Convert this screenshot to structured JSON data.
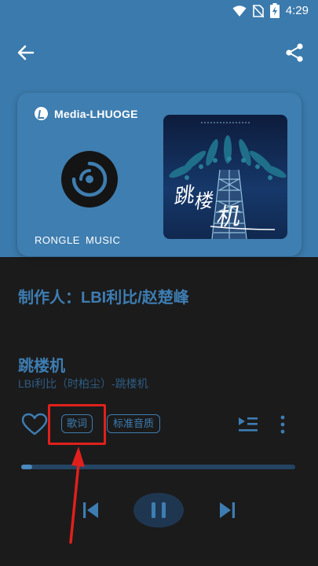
{
  "status_bar": {
    "time": "4:29"
  },
  "colors": {
    "header_bg": "#3b7aac",
    "accent": "#3d7db2",
    "body_bg": "#1b1b1b",
    "highlight": "#e0201c"
  },
  "icons": {
    "back": "arrow-back-icon",
    "share": "share-icon",
    "heart": "heart-outline-icon",
    "queue": "playlist-icon",
    "more": "more-vertical-icon",
    "prev": "skip-previous-icon",
    "pause": "pause-icon",
    "next": "skip-next-icon"
  },
  "card": {
    "brand": "Media-LHUOGE",
    "label": "RONGLE  MUSIC"
  },
  "producer": "制作人：LBI利比/赵楚峰",
  "song": {
    "title": "跳楼机",
    "subtitle": "LBI利比（时柏尘）-跳楼机"
  },
  "actions": {
    "lyrics": "歌词",
    "quality": "标准音质"
  },
  "playback": {
    "progress": 0.04
  }
}
